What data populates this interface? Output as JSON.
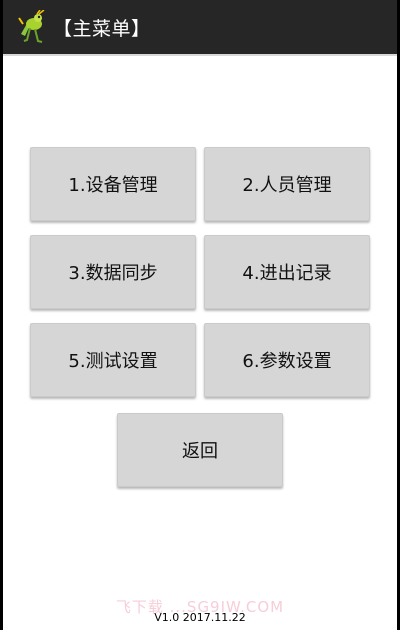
{
  "header": {
    "title": "【主菜单】",
    "logo_icon": "grasshopper-icon"
  },
  "menu": {
    "items": [
      {
        "label": "1.设备管理"
      },
      {
        "label": "2.人员管理"
      },
      {
        "label": "3.数据同步"
      },
      {
        "label": "4.进出记录"
      },
      {
        "label": "5.测试设置"
      },
      {
        "label": "6.参数设置"
      }
    ],
    "back_label": "返回"
  },
  "footer": {
    "version": "V1.0 2017.11.22",
    "watermark": "飞下载 ...SG9IW.COM"
  },
  "colors": {
    "titlebar": "#262626",
    "button": "#d6d6d6",
    "background": "#ffffff"
  }
}
